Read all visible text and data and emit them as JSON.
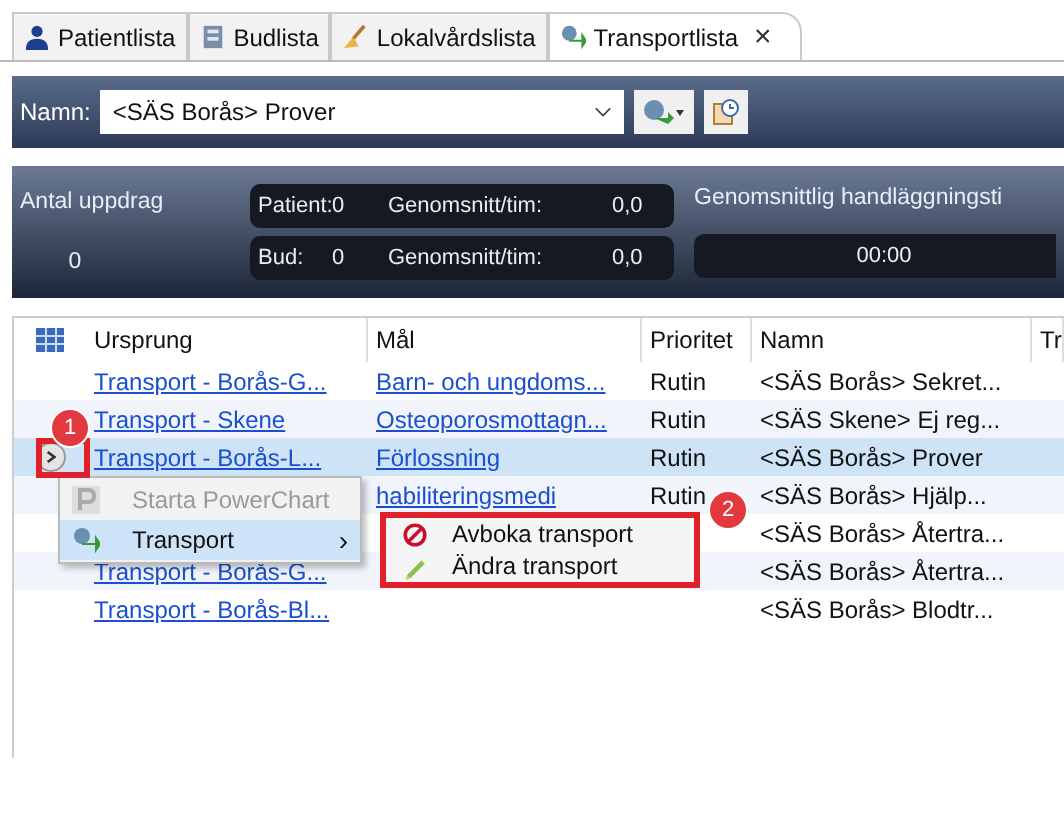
{
  "tabs": [
    {
      "label": "Patientlista",
      "selected": false
    },
    {
      "label": "Budlista",
      "selected": false
    },
    {
      "label": "Lokalvårdslista",
      "selected": false
    },
    {
      "label": "Transportlista",
      "selected": true,
      "close": "×"
    }
  ],
  "toolbar": {
    "label": "Namn:",
    "value": "<SÄS Borås> Prover"
  },
  "stats": {
    "count_label": "Antal uppdrag",
    "count_value": "0",
    "rows": [
      {
        "type_label": "Patient:",
        "count": "0",
        "avg_label": "Genomsnitt/tim:",
        "avg": "0,0"
      },
      {
        "type_label": "Bud:",
        "count": "0",
        "avg_label": "Genomsnitt/tim:",
        "avg": "0,0"
      }
    ],
    "handling_label": "Genomsnittlig handläggningsti",
    "handling_value": "00:00"
  },
  "table": {
    "columns": [
      "Ursprung",
      "Mål",
      "Prioritet",
      "Namn",
      "Tr"
    ],
    "rows": [
      {
        "ursprung": "Transport - Borås-G...",
        "mal": "Barn- och ungdoms...",
        "prioritet": "Rutin",
        "namn": "<SÄS Borås> Sekret...",
        "selected": false
      },
      {
        "ursprung": "Transport - Skene",
        "mal": "Osteoporosmottagn...",
        "prioritet": "Rutin",
        "namn": "<SÄS Skene> Ej reg...",
        "selected": false
      },
      {
        "ursprung": "Transport - Borås-L...",
        "mal": "Förlossning",
        "prioritet": "Rutin",
        "namn": "<SÄS Borås> Prover",
        "selected": true
      },
      {
        "mal": "habiliteringsmedi",
        "prioritet": "Rutin",
        "namn": "<SÄS Borås> Hjälp...",
        "selected": false
      },
      {
        "namn": "<SÄS Borås> Återtra...",
        "selected": false
      },
      {
        "ursprung": "Transport - Borås-G...",
        "namn": "<SÄS Borås> Återtra...",
        "selected": false
      },
      {
        "ursprung": "Transport - Borås-Bl...",
        "namn": "<SÄS Borås> Blodtr...",
        "selected": false
      }
    ]
  },
  "context_menu": {
    "items": [
      {
        "label": "Starta PowerChart",
        "disabled": true,
        "selected": false
      },
      {
        "label": "Transport",
        "disabled": false,
        "selected": true,
        "arrow": "›"
      }
    ]
  },
  "submenu": {
    "items": [
      {
        "label": "Avboka transport",
        "kind": "cancel"
      },
      {
        "label": "Ändra transport",
        "kind": "edit"
      }
    ]
  },
  "callouts": [
    {
      "number": "1"
    },
    {
      "number": "2"
    }
  ]
}
